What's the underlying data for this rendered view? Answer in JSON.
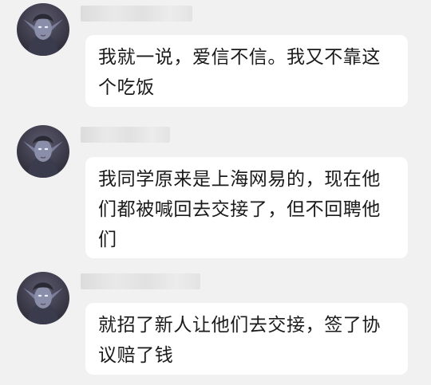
{
  "messages": [
    {
      "text": "我就一说，爱信不信。我又不靠这个吃饭"
    },
    {
      "text": "我同学原来是上海网易的，现在他们都被喊回去交接了，但不回聘他们"
    },
    {
      "text": "就招了新人让他们去交接，签了协议赔了钱"
    }
  ],
  "icons": {
    "avatar": "avatar-portrait-icon"
  },
  "colors": {
    "background": "#f1f1f1",
    "bubble": "#ffffff",
    "text": "#1a1a1a",
    "name_blur": "#e2e2e2"
  }
}
